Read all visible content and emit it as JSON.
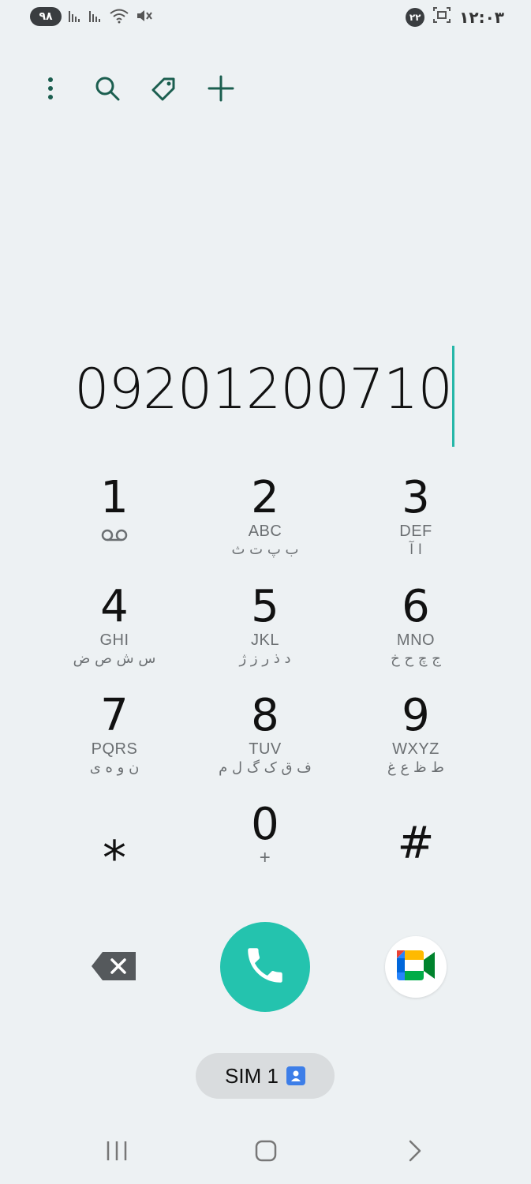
{
  "status_bar": {
    "battery": "۹۸",
    "notification_count": "۲۲",
    "clock": "۱۲:۰۳"
  },
  "toolbar": {
    "icons": [
      "more-options-icon",
      "search-icon",
      "tag-icon",
      "add-icon"
    ]
  },
  "dialer": {
    "number": "09201200710"
  },
  "keypad": [
    [
      {
        "digit": "1",
        "letters": "",
        "persian": "",
        "icon": "voicemail-icon"
      },
      {
        "digit": "2",
        "letters": "ABC",
        "persian": "ب پ ت ث"
      },
      {
        "digit": "3",
        "letters": "DEF",
        "persian": "ا آ"
      }
    ],
    [
      {
        "digit": "4",
        "letters": "GHI",
        "persian": "س ش ص ض"
      },
      {
        "digit": "5",
        "letters": "JKL",
        "persian": "د ذ ر ز ژ"
      },
      {
        "digit": "6",
        "letters": "MNO",
        "persian": "ج چ ح خ"
      }
    ],
    [
      {
        "digit": "7",
        "letters": "PQRS",
        "persian": "ن و ه ی"
      },
      {
        "digit": "8",
        "letters": "TUV",
        "persian": "ف ق ک گ ل م"
      },
      {
        "digit": "9",
        "letters": "WXYZ",
        "persian": "ط ظ ع غ"
      }
    ],
    [
      {
        "digit": "⁎",
        "letters": "",
        "persian": ""
      },
      {
        "digit": "0",
        "letters": "+",
        "persian": ""
      },
      {
        "digit": "#",
        "letters": "",
        "persian": ""
      }
    ]
  ],
  "sim": {
    "label": "SIM 1"
  },
  "colors": {
    "background": "#edf1f3",
    "accent": "#24c3ae",
    "toolbar_icon": "#1b5e4f",
    "cursor": "#26b7a8"
  }
}
